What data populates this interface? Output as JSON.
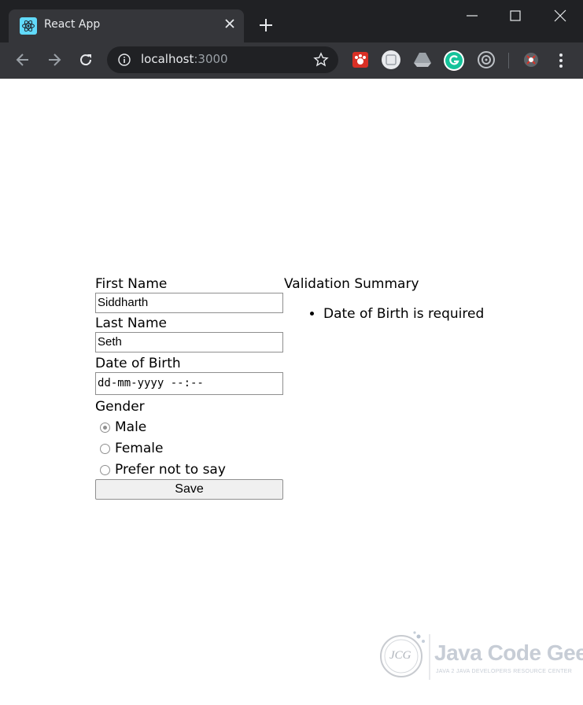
{
  "browser": {
    "tab_title": "React App",
    "url_host": "localhost",
    "url_port": ":3000"
  },
  "form": {
    "first_name_label": "First Name",
    "first_name_value": "Siddharth",
    "last_name_label": "Last Name",
    "last_name_value": "Seth",
    "dob_label": "Date of Birth",
    "dob_placeholder": "dd-mm-yyyy --:--",
    "gender_label": "Gender",
    "gender_options": [
      "Male",
      "Female",
      "Prefer not to say"
    ],
    "gender_selected": "Male",
    "save_label": "Save"
  },
  "summary": {
    "title": "Validation Summary",
    "errors": [
      "Date of Birth is required"
    ]
  },
  "watermark": {
    "logo_text": "JCG",
    "brand": "Java Code Geeks",
    "tagline": "JAVA 2 JAVA DEVELOPERS RESOURCE CENTER"
  },
  "colors": {
    "chrome_dark": "#202124",
    "toolbar": "#35363a",
    "react_blue": "#61dafb",
    "grammarly_green": "#15c39a"
  }
}
